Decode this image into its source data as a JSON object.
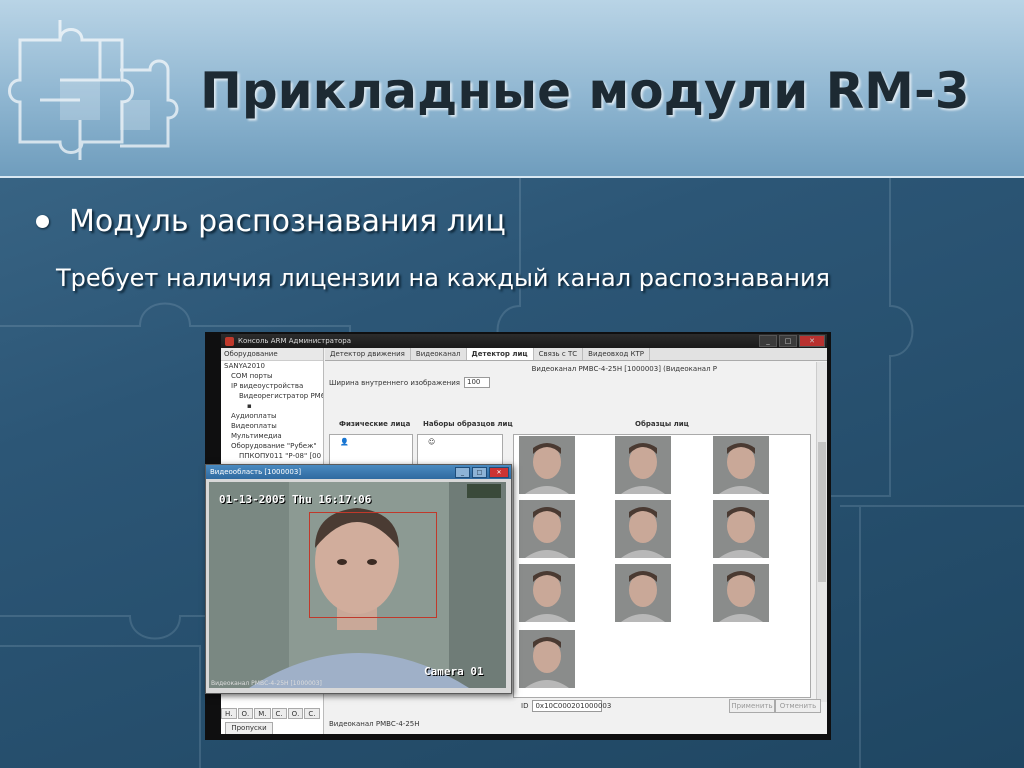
{
  "slide": {
    "title": "Прикладные модули RM-3",
    "bullet": "Модуль распознавания лиц",
    "subtext": "Требует наличия лицензии на каждый канал распознавания"
  },
  "app": {
    "window_title": "Консоль ARM Администратора",
    "title_buttons": [
      "_",
      "□",
      "✕"
    ],
    "tree_header": "Оборудование",
    "tree": [
      {
        "label": "SANYA2010",
        "level": 0
      },
      {
        "label": "COM порты",
        "level": 1
      },
      {
        "label": "IP видеоустройства",
        "level": 1
      },
      {
        "label": "Видеорегистратор PM6",
        "level": 2
      },
      {
        "label": "Аудиоплаты",
        "level": 1
      },
      {
        "label": "Видеоплаты",
        "level": 1
      },
      {
        "label": "Мультимедиа",
        "level": 1
      },
      {
        "label": "Оборудование \"Рубеж\"",
        "level": 1
      },
      {
        "label": "ППКОПУ011 \"Р-08\" [00",
        "level": 2
      }
    ],
    "bottom_tabs": [
      "Н.",
      "О.",
      "М.",
      "С.",
      "О.",
      "С."
    ],
    "bottom_button": "Пропуски",
    "tabs": [
      "Детектор движения",
      "Видеоканал",
      "Детектор лиц",
      "Связь с ТС",
      "Видеовход КТР"
    ],
    "channel_label": "Видеоканал РМВС-4-25Н [1000003] (Видеоканал Р",
    "width_label": "Ширина внутреннего изображения",
    "width_value": "100",
    "col_physical": "Физические лица",
    "col_sets": "Наборы образцов лиц",
    "col_samples": "Образцы лиц",
    "id_label": "ID",
    "id_value": "0x10C000201000003",
    "apply_label": "Применить",
    "cancel_label": "Отменить",
    "status_bottom": "Видеоканал РМВС-4-25Н"
  },
  "video": {
    "title": "Видеообласть [1000003]",
    "osd_date": "01-13-2005 Thu 16:17:06",
    "osd_camera": "Camera 01",
    "osd_bottom": "Видеоканал РМВС-4-25Н [1000003]",
    "buttons": [
      "_",
      "□",
      "✕"
    ]
  }
}
